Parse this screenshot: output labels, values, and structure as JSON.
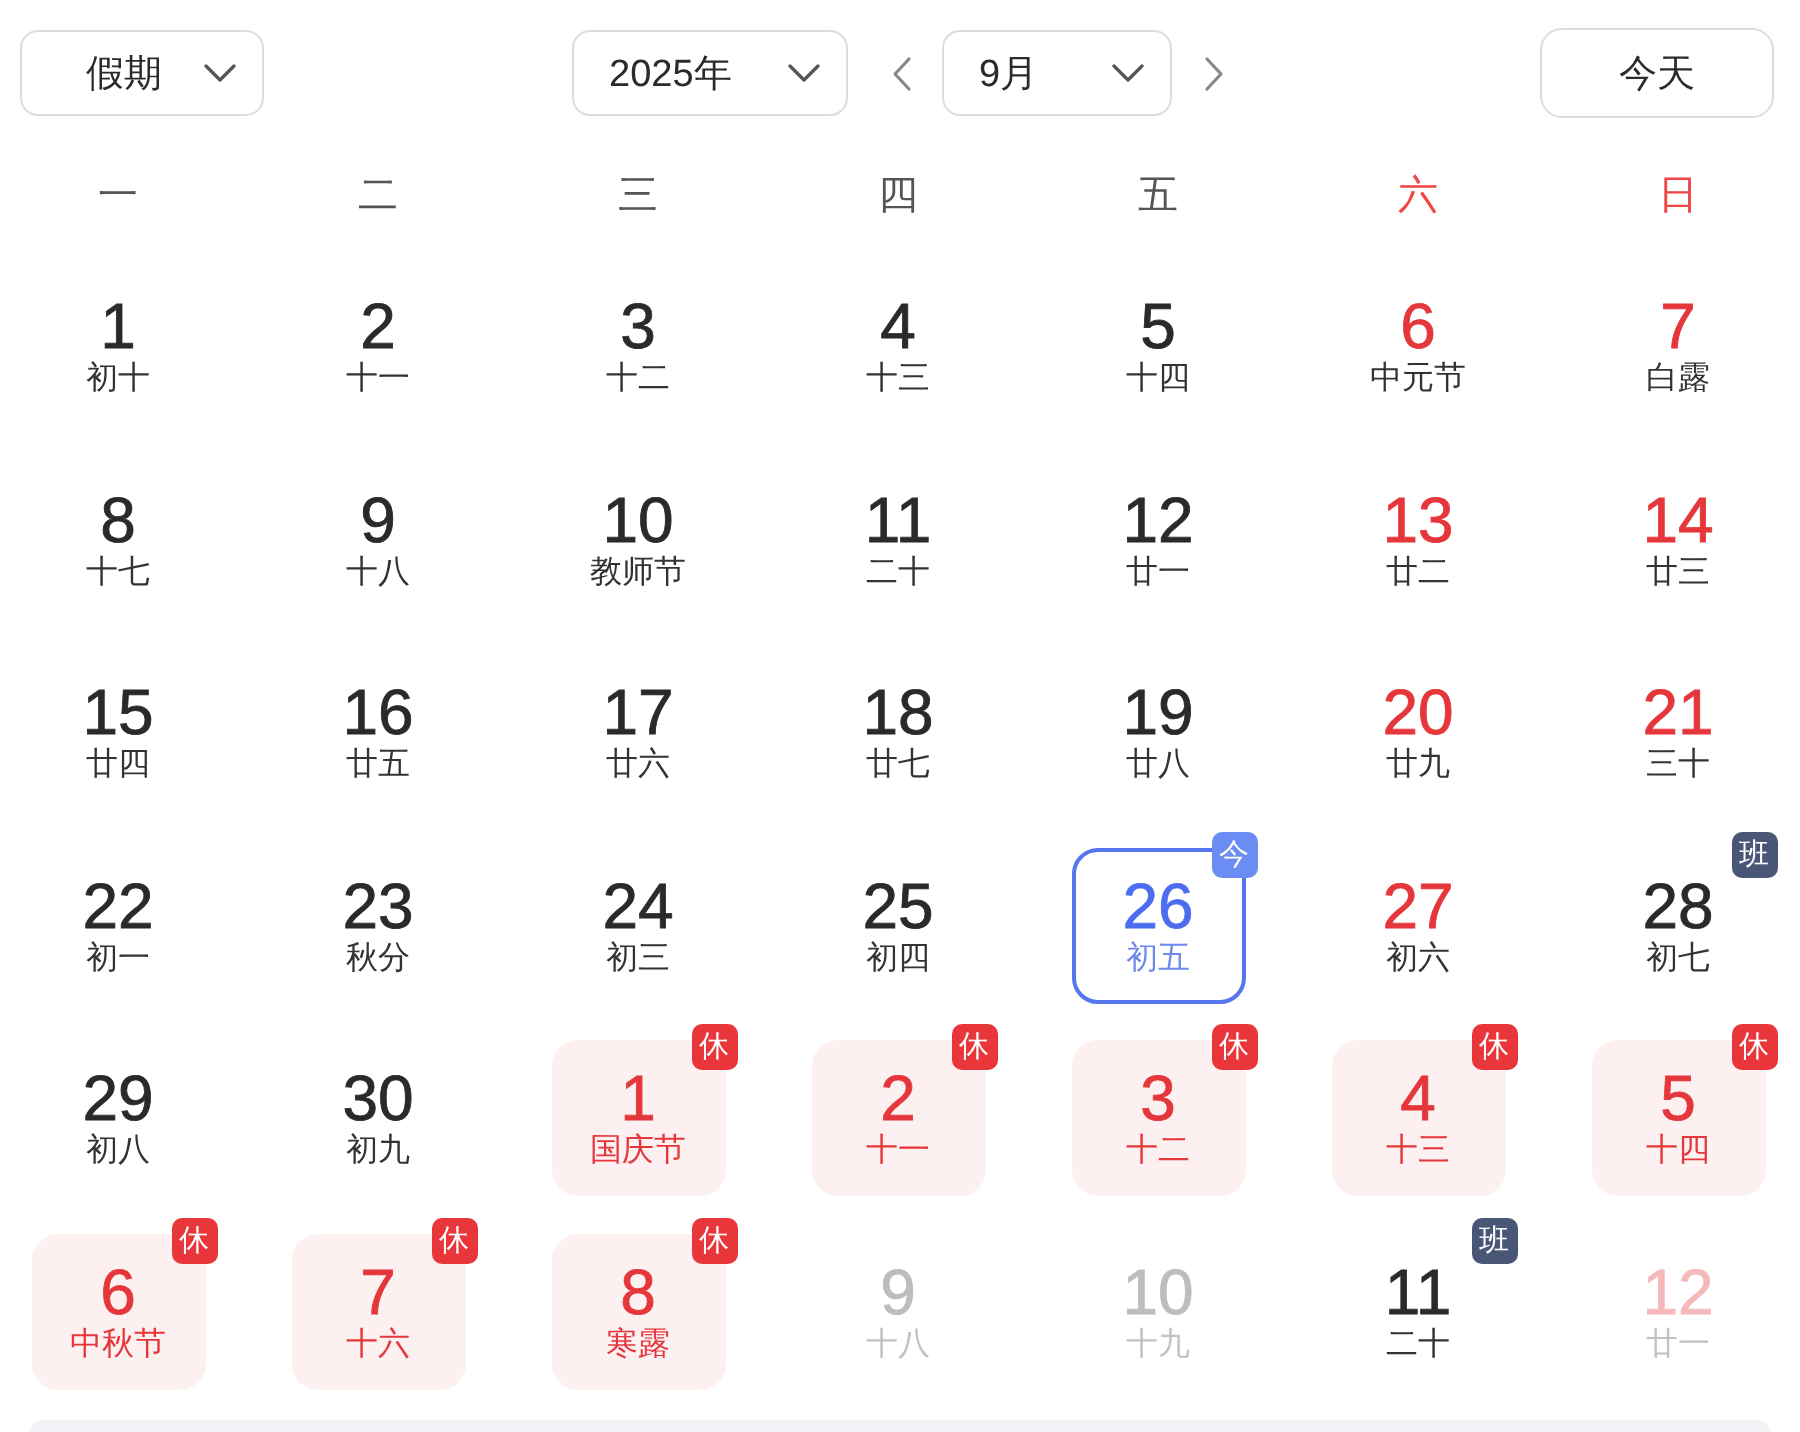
{
  "toolbar": {
    "holiday_select": {
      "value": "假期"
    },
    "year_select": {
      "value": "2025年"
    },
    "month_select": {
      "value": "9月"
    },
    "today_button": {
      "label": "今天"
    }
  },
  "weekdays": [
    {
      "label": "一",
      "weekend": false
    },
    {
      "label": "二",
      "weekend": false
    },
    {
      "label": "三",
      "weekend": false
    },
    {
      "label": "四",
      "weekend": false
    },
    {
      "label": "五",
      "weekend": false
    },
    {
      "label": "六",
      "weekend": true
    },
    {
      "label": "日",
      "weekend": true
    }
  ],
  "days": [
    {
      "day": "1",
      "lunar": "初十",
      "kind": "workday",
      "selected": false
    },
    {
      "day": "2",
      "lunar": "十一",
      "kind": "workday",
      "selected": false
    },
    {
      "day": "3",
      "lunar": "十二",
      "kind": "workday",
      "selected": false
    },
    {
      "day": "4",
      "lunar": "十三",
      "kind": "workday",
      "selected": false
    },
    {
      "day": "5",
      "lunar": "十四",
      "kind": "workday",
      "selected": false
    },
    {
      "day": "6",
      "lunar": "中元节",
      "kind": "weekend",
      "selected": false
    },
    {
      "day": "7",
      "lunar": "白露",
      "kind": "weekend",
      "selected": false
    },
    {
      "day": "8",
      "lunar": "十七",
      "kind": "workday",
      "selected": false
    },
    {
      "day": "9",
      "lunar": "十八",
      "kind": "workday",
      "selected": false
    },
    {
      "day": "10",
      "lunar": "教师节",
      "kind": "workday",
      "selected": false
    },
    {
      "day": "11",
      "lunar": "二十",
      "kind": "workday",
      "selected": false
    },
    {
      "day": "12",
      "lunar": "廿一",
      "kind": "workday",
      "selected": false
    },
    {
      "day": "13",
      "lunar": "廿二",
      "kind": "weekend",
      "selected": false
    },
    {
      "day": "14",
      "lunar": "廿三",
      "kind": "weekend",
      "selected": false
    },
    {
      "day": "15",
      "lunar": "廿四",
      "kind": "workday",
      "selected": false
    },
    {
      "day": "16",
      "lunar": "廿五",
      "kind": "workday",
      "selected": false
    },
    {
      "day": "17",
      "lunar": "廿六",
      "kind": "workday",
      "selected": false
    },
    {
      "day": "18",
      "lunar": "廿七",
      "kind": "workday",
      "selected": false
    },
    {
      "day": "19",
      "lunar": "廿八",
      "kind": "workday",
      "selected": false
    },
    {
      "day": "20",
      "lunar": "廿九",
      "kind": "weekend",
      "selected": false
    },
    {
      "day": "21",
      "lunar": "三十",
      "kind": "weekend",
      "selected": false
    },
    {
      "day": "22",
      "lunar": "初一",
      "kind": "workday",
      "selected": false
    },
    {
      "day": "23",
      "lunar": "秋分",
      "kind": "workday",
      "selected": false
    },
    {
      "day": "24",
      "lunar": "初三",
      "kind": "workday",
      "selected": false
    },
    {
      "day": "25",
      "lunar": "初四",
      "kind": "workday",
      "selected": false
    },
    {
      "day": "26",
      "lunar": "初五",
      "kind": "workday",
      "selected": true,
      "badge": {
        "kind": "today",
        "text": "今"
      }
    },
    {
      "day": "27",
      "lunar": "初六",
      "kind": "weekend",
      "selected": false
    },
    {
      "day": "28",
      "lunar": "初七",
      "kind": "workday",
      "selected": false,
      "badge": {
        "kind": "work",
        "text": "班"
      }
    },
    {
      "day": "29",
      "lunar": "初八",
      "kind": "workday",
      "selected": false
    },
    {
      "day": "30",
      "lunar": "初九",
      "kind": "workday",
      "selected": false
    },
    {
      "day": "1",
      "lunar": "国庆节",
      "kind": "holiday",
      "selected": false,
      "badge": {
        "kind": "rest",
        "text": "休"
      }
    },
    {
      "day": "2",
      "lunar": "十一",
      "kind": "holiday",
      "selected": false,
      "badge": {
        "kind": "rest",
        "text": "休"
      }
    },
    {
      "day": "3",
      "lunar": "十二",
      "kind": "holiday",
      "selected": false,
      "badge": {
        "kind": "rest",
        "text": "休"
      }
    },
    {
      "day": "4",
      "lunar": "十三",
      "kind": "holiday",
      "selected": false,
      "badge": {
        "kind": "rest",
        "text": "休"
      }
    },
    {
      "day": "5",
      "lunar": "十四",
      "kind": "holiday",
      "selected": false,
      "badge": {
        "kind": "rest",
        "text": "休"
      }
    },
    {
      "day": "6",
      "lunar": "中秋节",
      "kind": "holiday",
      "selected": false,
      "badge": {
        "kind": "rest",
        "text": "休"
      }
    },
    {
      "day": "7",
      "lunar": "十六",
      "kind": "holiday",
      "selected": false,
      "badge": {
        "kind": "rest",
        "text": "休"
      }
    },
    {
      "day": "8",
      "lunar": "寒露",
      "kind": "holiday",
      "selected": false,
      "badge": {
        "kind": "rest",
        "text": "休"
      }
    },
    {
      "day": "9",
      "lunar": "十八",
      "kind": "adjacent",
      "selected": false
    },
    {
      "day": "10",
      "lunar": "十九",
      "kind": "adjacent",
      "selected": false
    },
    {
      "day": "11",
      "lunar": "二十",
      "kind": "workday",
      "selected": false,
      "badge": {
        "kind": "work",
        "text": "班"
      }
    },
    {
      "day": "12",
      "lunar": "廿一",
      "kind": "adjacent_weekend",
      "selected": false
    }
  ]
}
